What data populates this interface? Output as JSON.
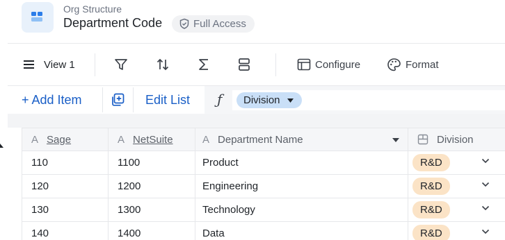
{
  "header": {
    "breadcrumb": "Org Structure",
    "title": "Department Code",
    "access_label": "Full Access",
    "app_icon": "grid-app-icon",
    "accent_color": "#1a5fc7"
  },
  "toolbar": {
    "view_label": "View 1",
    "configure_label": "Configure",
    "format_label": "Format",
    "icons": [
      "menu-icon",
      "filter-icon",
      "sort-icon",
      "sum-icon",
      "group-icon",
      "configure-icon",
      "palette-icon"
    ]
  },
  "actions": {
    "add_item_label": "+ Add Item",
    "edit_list_label": "Edit List",
    "formula_symbol": "ƒ",
    "formula_chip_label": "Division"
  },
  "table": {
    "columns": [
      {
        "label": "Sage",
        "icon": "text-field-icon"
      },
      {
        "label": "NetSuite",
        "icon": "text-field-icon"
      },
      {
        "label": "Department Name",
        "icon": "text-field-icon"
      },
      {
        "label": "Division",
        "icon": "layout-field-icon"
      }
    ],
    "rows": [
      {
        "sage": "110",
        "netsuite": "1100",
        "name": "Product",
        "division": "R&D"
      },
      {
        "sage": "120",
        "netsuite": "1200",
        "name": "Engineering",
        "division": "R&D"
      },
      {
        "sage": "130",
        "netsuite": "1300",
        "name": "Technology",
        "division": "R&D"
      },
      {
        "sage": "140",
        "netsuite": "1400",
        "name": "Data",
        "division": "R&D"
      }
    ],
    "division_badge_color": "#fbe3c6"
  }
}
